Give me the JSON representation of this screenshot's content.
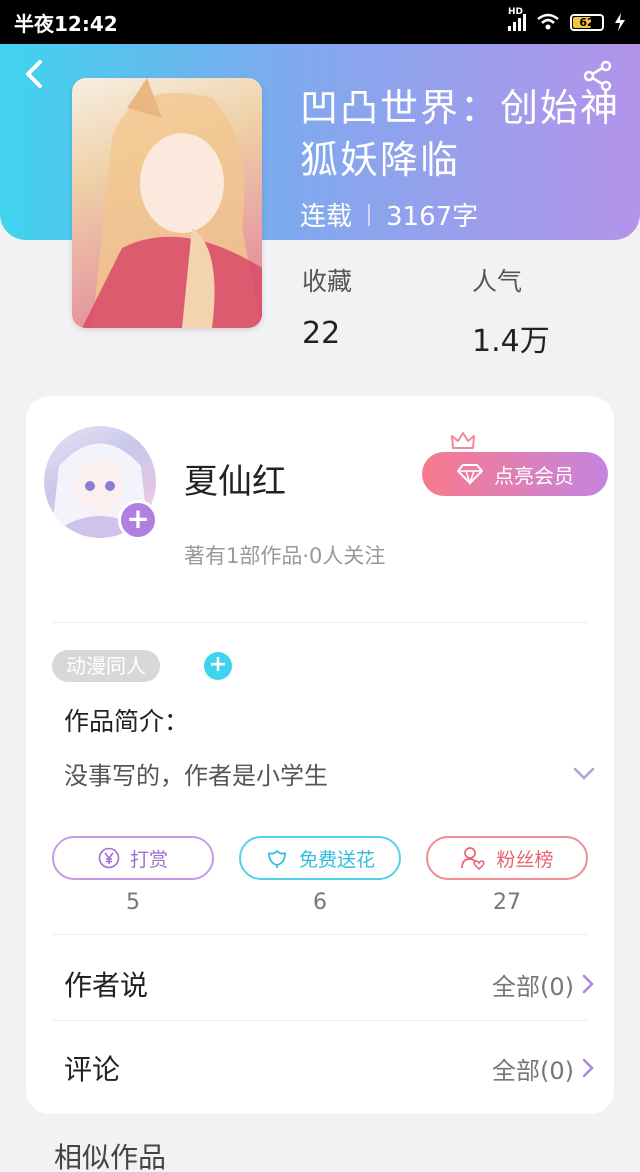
{
  "status_bar": {
    "time": "半夜12:42",
    "battery": "62",
    "signal_label": "HD"
  },
  "book": {
    "title": "凹凸世界：创始神狐妖降临",
    "status": "连载",
    "word_count": "3167字",
    "stats": [
      {
        "label": "收藏",
        "value": "22"
      },
      {
        "label": "人气",
        "value": "1.4万"
      }
    ]
  },
  "author": {
    "name": "夏仙红",
    "info": "著有1部作品·0人关注",
    "vip_label": "点亮会员"
  },
  "tag": {
    "label": "动漫同人"
  },
  "intro": {
    "label": "作品简介：",
    "text": "没事写的，作者是小学生"
  },
  "actions": [
    {
      "label": "打赏",
      "count": "5",
      "icon": "yen-icon"
    },
    {
      "label": "免费送花",
      "count": "6",
      "icon": "flower-icon"
    },
    {
      "label": "粉丝榜",
      "count": "27",
      "icon": "user-heart-icon"
    }
  ],
  "author_says": {
    "label": "作者说",
    "more": "全部(0)"
  },
  "comments": {
    "label": "评论",
    "more": "全部(0)"
  },
  "similar": {
    "label": "相似作品"
  },
  "colors": {
    "accent_purple": "#b07fe0",
    "accent_cyan": "#3fd3ef",
    "accent_red": "#f87a8c"
  }
}
